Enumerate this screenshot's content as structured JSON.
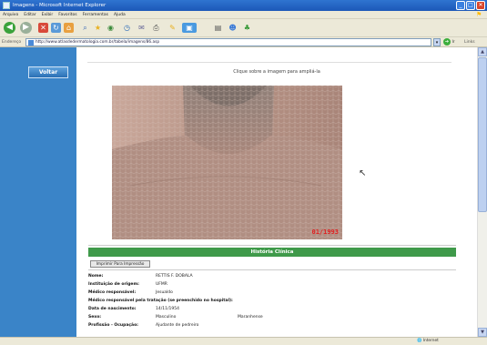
{
  "window": {
    "title": "Imagens - Microsoft Internet Explorer",
    "buttons": {
      "minimize": "_",
      "maximize": "□",
      "close": "✕"
    }
  },
  "menu": [
    "Arquivo",
    "Editar",
    "Exibir",
    "Favoritos",
    "Ferramentas",
    "Ajuda"
  ],
  "address": {
    "label": "Endereço",
    "url": "http://www.atlasdedermatologia.com.br/tabela/imagens/86.asp",
    "go_label": "Ir",
    "links_label": "Links"
  },
  "sidebar": {
    "back_label": "Voltar"
  },
  "content": {
    "click_hint": "Clique sobre a imagem para ampliá-la",
    "photo_stamp": "01/1993",
    "section_title": "História Clínica",
    "print_label": "Imprimir Para Impressão",
    "rows": [
      {
        "label": "Nome:",
        "value": "RETTIS F. DOBALA"
      },
      {
        "label": "Instituição de origem:",
        "value": "UFMR"
      },
      {
        "label": "Médico responsável:",
        "value": "Jesualdo"
      },
      {
        "label": "Médico responsável pela tratação (se preenchido no hospital):",
        "value": ""
      },
      {
        "label": "Data de nascimento:",
        "value": "14/11/1954"
      },
      {
        "label": "Sexo:",
        "value": "Masculino",
        "extra": "Maranhense"
      },
      {
        "label": "Profissão - Ocupação:",
        "value": "Ajudante de pedreiro"
      }
    ]
  },
  "status": {
    "zone": "Internet"
  },
  "icons": {
    "back": "back-arrow-icon",
    "forward": "forward-arrow-icon",
    "stop": "stop-icon",
    "refresh": "refresh-icon",
    "home": "home-icon",
    "search": "search-icon",
    "favorites": "favorites-star-icon",
    "media": "media-icon",
    "history": "history-icon",
    "mail": "mail-icon",
    "print": "print-icon",
    "edit": "edit-icon",
    "folder": "folder-icon",
    "messenger": "messenger-icon"
  },
  "colors": {
    "titlebar": "#1c58b8",
    "sidebar": "#3a84c8",
    "section_bar": "#3f9a4a",
    "stamp": "#e02020"
  }
}
